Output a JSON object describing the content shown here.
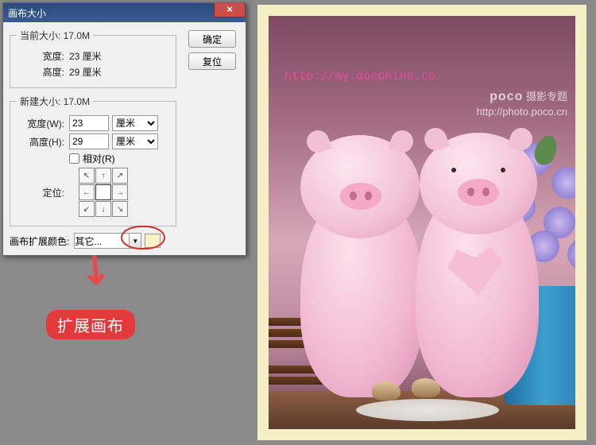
{
  "dialog": {
    "title": "画布大小",
    "close": "×",
    "ok": "确定",
    "reset": "复位",
    "current": {
      "legend": "当前大小: 17.0M",
      "width_label": "宽度:",
      "width_value": "23 厘米",
      "height_label": "高度:",
      "height_value": "29 厘米"
    },
    "new": {
      "legend": "新建大小: 17.0M",
      "width_label": "宽度(W):",
      "width_value": "23",
      "width_unit": "厘米",
      "height_label": "高度(H):",
      "height_value": "29",
      "height_unit": "厘米",
      "relative_label": "相对(R)",
      "anchor_label": "定位:"
    },
    "extension": {
      "label": "画布扩展颜色:",
      "value": "其它...",
      "swatch_color": "#f8f0c7"
    }
  },
  "annotation": {
    "tag": "扩展画布"
  },
  "watermark": {
    "url": "http://my.doephine.co",
    "brand": "poco",
    "brand_sub": "摄影专题",
    "brand_url": "http://photo.poco.cn"
  }
}
